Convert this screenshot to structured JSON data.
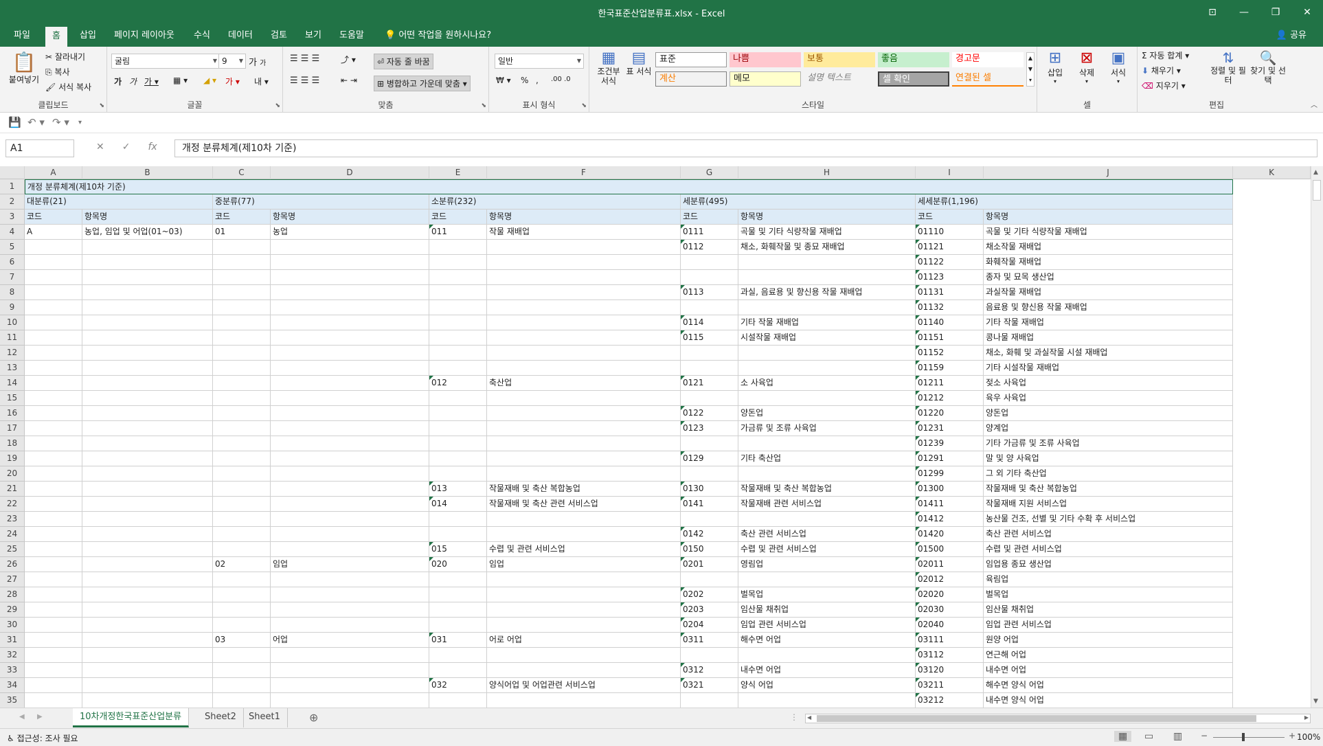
{
  "window": {
    "title": "한국표준산업분류표.xlsx  -  Excel"
  },
  "menu": {
    "tabs": [
      "파일",
      "홈",
      "삽입",
      "페이지 레이아웃",
      "수식",
      "데이터",
      "검토",
      "보기",
      "도움말"
    ],
    "tellme": "어떤 작업을 원하시나요?",
    "share": "공유"
  },
  "ribbon": {
    "clipboard": {
      "paste": "붙여넣기",
      "cut": "잘라내기",
      "copy": "복사",
      "format_painter": "서식 복사",
      "label": "클립보드"
    },
    "font": {
      "name": "굴림",
      "size": "9",
      "label": "글꼴"
    },
    "align": {
      "wrap": "자동 줄 바꿈",
      "merge": "병합하고 가운데 맞춤",
      "label": "맞춤"
    },
    "number": {
      "format": "일반",
      "label": "표시 형식"
    },
    "styles": {
      "conditional": "조건부 서식",
      "table": "표 서식",
      "cells": [
        "표준",
        "나쁨",
        "보통",
        "좋음",
        "경고문",
        "계산",
        "메모",
        "설명 텍스트",
        "셀 확인",
        "연결된 셀"
      ],
      "label": "스타일"
    },
    "cells": {
      "insert": "삽입",
      "delete": "삭제",
      "format": "서식",
      "label": "셀"
    },
    "editing": {
      "autosum": "자동 합계",
      "fill": "채우기",
      "clear": "지우기",
      "sort": "정렬 및 필터",
      "find": "찾기 및 선택",
      "label": "편집"
    }
  },
  "formula_bar": {
    "name_box": "A1",
    "content": "개정 분류체계(제10차 기준)"
  },
  "columns": [
    "A",
    "B",
    "C",
    "D",
    "E",
    "F",
    "G",
    "H",
    "I",
    "J",
    "K"
  ],
  "rows": [
    {
      "n": "1",
      "t": "개정 분류체계(제10차 기준)"
    },
    {
      "n": "2",
      "h": [
        "대분류(21)",
        "중분류(77)",
        "소분류(232)",
        "세분류(495)",
        "세세분류(1,196)"
      ]
    },
    {
      "n": "3",
      "c": [
        "코드",
        "항목명",
        "코드",
        "항목명",
        "코드",
        "항목명",
        "코드",
        "항목명",
        "코드",
        "항목명"
      ]
    },
    {
      "n": "4",
      "c": [
        "A",
        "농업, 임업 및 어업(01~03)",
        "01",
        "농업",
        "011",
        "작물 재배업",
        "0111",
        "곡물 및 기타 식량작물 재배업",
        "01110",
        "곡물 및 기타 식량작물 재배업"
      ]
    },
    {
      "n": "5",
      "c": [
        "",
        "",
        "",
        "",
        "",
        "",
        "0112",
        "채소, 화훼작물 및 종묘 재배업",
        "01121",
        "채소작물 재배업"
      ]
    },
    {
      "n": "6",
      "c": [
        "",
        "",
        "",
        "",
        "",
        "",
        "",
        "",
        "01122",
        "화훼작물 재배업"
      ]
    },
    {
      "n": "7",
      "c": [
        "",
        "",
        "",
        "",
        "",
        "",
        "",
        "",
        "01123",
        "종자 및 묘목 생산업"
      ]
    },
    {
      "n": "8",
      "c": [
        "",
        "",
        "",
        "",
        "",
        "",
        "0113",
        "과실, 음료용 및 향신용 작물 재배업",
        "01131",
        "과실작물 재배업"
      ]
    },
    {
      "n": "9",
      "c": [
        "",
        "",
        "",
        "",
        "",
        "",
        "",
        "",
        "01132",
        "음료용 및 향신용 작물 재배업"
      ]
    },
    {
      "n": "10",
      "c": [
        "",
        "",
        "",
        "",
        "",
        "",
        "0114",
        "기타 작물 재배업",
        "01140",
        "기타 작물 재배업"
      ]
    },
    {
      "n": "11",
      "c": [
        "",
        "",
        "",
        "",
        "",
        "",
        "0115",
        "시설작물 재배업",
        "01151",
        "콩나물 재배업"
      ]
    },
    {
      "n": "12",
      "c": [
        "",
        "",
        "",
        "",
        "",
        "",
        "",
        "",
        "01152",
        "채소, 화훼 및 과실작물 시설 재배업"
      ]
    },
    {
      "n": "13",
      "c": [
        "",
        "",
        "",
        "",
        "",
        "",
        "",
        "",
        "01159",
        "기타 시설작물 재배업"
      ]
    },
    {
      "n": "14",
      "c": [
        "",
        "",
        "",
        "",
        "012",
        "축산업",
        "0121",
        "소 사육업",
        "01211",
        "젖소 사육업"
      ]
    },
    {
      "n": "15",
      "c": [
        "",
        "",
        "",
        "",
        "",
        "",
        "",
        "",
        "01212",
        "육우 사육업"
      ]
    },
    {
      "n": "16",
      "c": [
        "",
        "",
        "",
        "",
        "",
        "",
        "0122",
        "양돈업",
        "01220",
        "양돈업"
      ]
    },
    {
      "n": "17",
      "c": [
        "",
        "",
        "",
        "",
        "",
        "",
        "0123",
        "가금류 및 조류 사육업",
        "01231",
        "양계업"
      ]
    },
    {
      "n": "18",
      "c": [
        "",
        "",
        "",
        "",
        "",
        "",
        "",
        "",
        "01239",
        "기타 가금류 및 조류 사육업"
      ]
    },
    {
      "n": "19",
      "c": [
        "",
        "",
        "",
        "",
        "",
        "",
        "0129",
        "기타 축산업",
        "01291",
        "말 및 양 사육업"
      ]
    },
    {
      "n": "20",
      "c": [
        "",
        "",
        "",
        "",
        "",
        "",
        "",
        "",
        "01299",
        "그 외 기타 축산업"
      ]
    },
    {
      "n": "21",
      "c": [
        "",
        "",
        "",
        "",
        "013",
        "작물재배 및 축산 복합농업",
        "0130",
        "작물재배 및 축산 복합농업",
        "01300",
        "작물재배 및 축산 복합농업"
      ]
    },
    {
      "n": "22",
      "c": [
        "",
        "",
        "",
        "",
        "014",
        "작물재배 및 축산 관련 서비스업",
        "0141",
        "작물재배 관련 서비스업",
        "01411",
        "작물재배 지원 서비스업"
      ]
    },
    {
      "n": "23",
      "c": [
        "",
        "",
        "",
        "",
        "",
        "",
        "",
        "",
        "01412",
        "농산물 건조, 선별 및 기타 수확 후 서비스업"
      ]
    },
    {
      "n": "24",
      "c": [
        "",
        "",
        "",
        "",
        "",
        "",
        "0142",
        "축산 관련 서비스업",
        "01420",
        "축산 관련 서비스업"
      ]
    },
    {
      "n": "25",
      "c": [
        "",
        "",
        "",
        "",
        "015",
        "수렵 및 관련 서비스업",
        "0150",
        "수렵 및 관련 서비스업",
        "01500",
        "수렵 및 관련 서비스업"
      ]
    },
    {
      "n": "26",
      "c": [
        "",
        "",
        "02",
        "임업",
        "020",
        "임업",
        "0201",
        "영림업",
        "02011",
        "임업용 종묘 생산업"
      ]
    },
    {
      "n": "27",
      "c": [
        "",
        "",
        "",
        "",
        "",
        "",
        "",
        "",
        "02012",
        "육림업"
      ]
    },
    {
      "n": "28",
      "c": [
        "",
        "",
        "",
        "",
        "",
        "",
        "0202",
        "벌목업",
        "02020",
        "벌목업"
      ]
    },
    {
      "n": "29",
      "c": [
        "",
        "",
        "",
        "",
        "",
        "",
        "0203",
        "임산물 채취업",
        "02030",
        "임산물 채취업"
      ]
    },
    {
      "n": "30",
      "c": [
        "",
        "",
        "",
        "",
        "",
        "",
        "0204",
        "임업 관련 서비스업",
        "02040",
        "임업 관련 서비스업"
      ]
    },
    {
      "n": "31",
      "c": [
        "",
        "",
        "03",
        "어업",
        "031",
        "어로 어업",
        "0311",
        "해수면 어업",
        "03111",
        "원양 어업"
      ]
    },
    {
      "n": "32",
      "c": [
        "",
        "",
        "",
        "",
        "",
        "",
        "",
        "",
        "03112",
        "연근해 어업"
      ]
    },
    {
      "n": "33",
      "c": [
        "",
        "",
        "",
        "",
        "",
        "",
        "0312",
        "내수면 어업",
        "03120",
        "내수면 어업"
      ]
    },
    {
      "n": "34",
      "c": [
        "",
        "",
        "",
        "",
        "032",
        "양식어업 및 어업관련 서비스업",
        "0321",
        "양식 어업",
        "03211",
        "해수면 양식 어업"
      ]
    },
    {
      "n": "35",
      "c": [
        "",
        "",
        "",
        "",
        "",
        "",
        "",
        "",
        "03212",
        "내수면 양식 어업"
      ]
    }
  ],
  "sheets": [
    "10차개정한국표준산업분류",
    "Sheet2",
    "Sheet1"
  ],
  "status": {
    "accessibility": "접근성: 조사 필요",
    "zoom": "100%"
  }
}
